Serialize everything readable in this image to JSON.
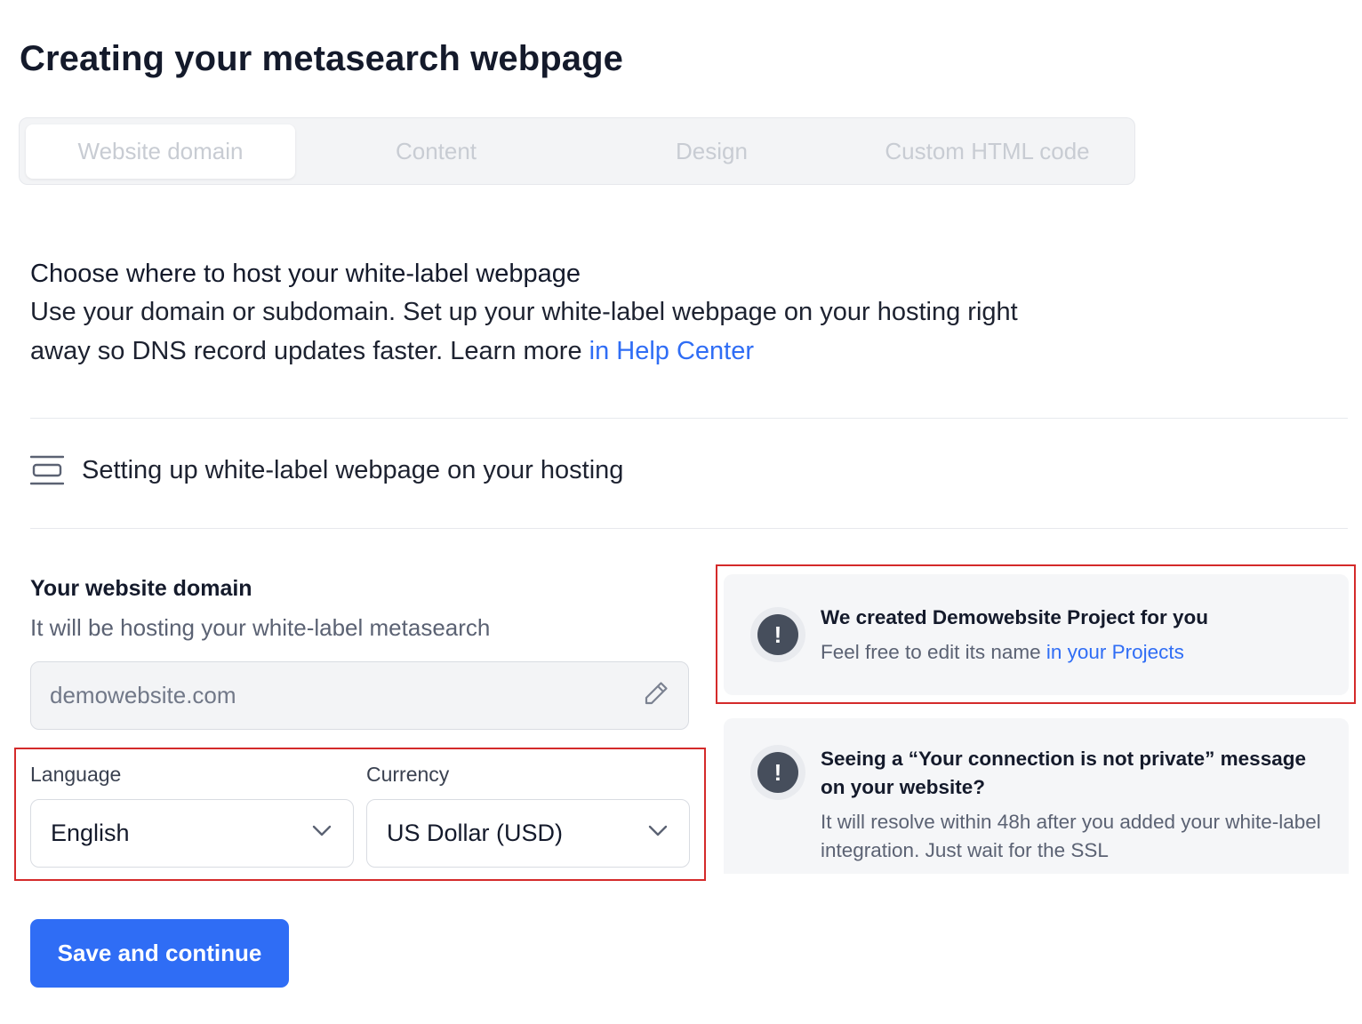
{
  "page": {
    "title": "Creating your metasearch webpage"
  },
  "tabs": [
    {
      "label": "Website domain",
      "active": true
    },
    {
      "label": "Content",
      "active": false
    },
    {
      "label": "Design",
      "active": false
    },
    {
      "label": "Custom HTML code",
      "active": false
    }
  ],
  "intro": {
    "heading": "Choose where to host your white-label webpage",
    "body": "Use your domain or subdomain. Set up your white-label webpage on your hosting right away so DNS record updates faster. Learn more ",
    "link": "in Help Center"
  },
  "hosting": {
    "label": "Setting up white-label webpage on your hosting",
    "icon": "hosting-layout-icon"
  },
  "domain": {
    "heading": "Your website domain",
    "subtitle": "It will be hosting your white-label metasearch",
    "value": "demowebsite.com",
    "edit_icon": "pencil-icon"
  },
  "language": {
    "label": "Language",
    "value": "English"
  },
  "currency": {
    "label": "Currency",
    "value": "US Dollar (USD)"
  },
  "cards": [
    {
      "title": "We created Demowebsite Project for you",
      "text": "Feel free to edit its name ",
      "link": "in your Projects",
      "icon": "exclamation-icon"
    },
    {
      "title": "Seeing a “Your connection is not private” message on your website?",
      "text": "It will resolve within 48h after you added your white-label integration. Just wait for the SSL",
      "icon": "exclamation-icon"
    }
  ],
  "actions": {
    "save_label": "Save and continue"
  },
  "colors": {
    "accent": "#2f6df5",
    "highlight": "#d42a2a"
  }
}
